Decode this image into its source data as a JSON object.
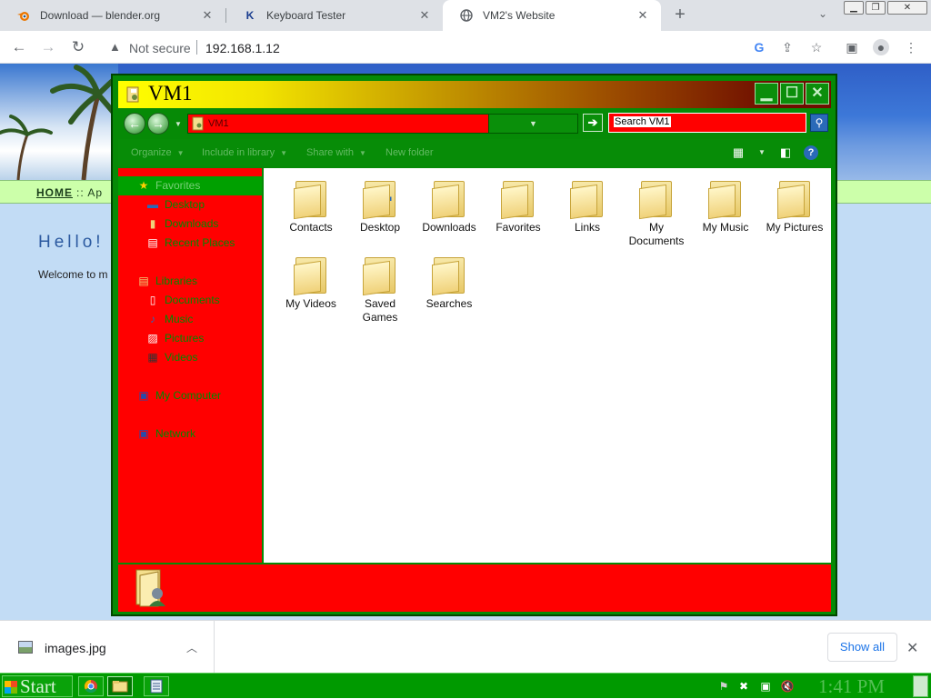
{
  "browser": {
    "tabs": [
      {
        "label": "Download — blender.org",
        "favicon": "blender-icon",
        "active": false
      },
      {
        "label": "Keyboard Tester",
        "favicon": "k-logo-icon",
        "active": false
      },
      {
        "label": "VM2's Website",
        "favicon": "globe-icon",
        "active": true
      }
    ],
    "omnibox": {
      "security": "Not secure",
      "url": "192.168.1.12"
    },
    "toolbar_icons": [
      "google-icon",
      "share-icon",
      "star-icon",
      "sidebar-icon",
      "profile-icon",
      "menu-icon"
    ]
  },
  "page": {
    "nav_home": "HOME",
    "nav_rest": ":: Ap",
    "heading": "Hello!",
    "welcome": "Welcome to m"
  },
  "explorer": {
    "title": "VM1",
    "address": "VM1",
    "search_placeholder": "Search VM1",
    "commands": [
      "Organize",
      "Include in library",
      "Share with",
      "New folder"
    ],
    "nav": {
      "favorites": {
        "label": "Favorites",
        "items": [
          "Desktop",
          "Downloads",
          "Recent Places"
        ]
      },
      "libraries": {
        "label": "Libraries",
        "items": [
          "Documents",
          "Music",
          "Pictures",
          "Videos"
        ]
      },
      "computer": "My Computer",
      "network": "Network"
    },
    "folders": [
      {
        "name": "Contacts",
        "icon": "contacts-icon"
      },
      {
        "name": "Desktop",
        "icon": "desktop-icon"
      },
      {
        "name": "Downloads",
        "icon": "downloads-icon"
      },
      {
        "name": "Favorites",
        "icon": "favorites-icon"
      },
      {
        "name": "Links",
        "icon": "links-icon"
      },
      {
        "name": "My Documents",
        "icon": "documents-icon"
      },
      {
        "name": "My Music",
        "icon": "music-icon"
      },
      {
        "name": "My Pictures",
        "icon": "pictures-icon"
      },
      {
        "name": "My Videos",
        "icon": "videos-icon"
      },
      {
        "name": "Saved Games",
        "icon": "games-icon"
      },
      {
        "name": "Searches",
        "icon": "searches-icon"
      }
    ],
    "colors": {
      "frame": "#068a06",
      "pane": "#ff0000",
      "nav_text": "#008800"
    }
  },
  "downloads": {
    "file": "images.jpg",
    "show_all": "Show all"
  },
  "taskbar": {
    "start": "Start",
    "clock": "1:41 PM"
  }
}
